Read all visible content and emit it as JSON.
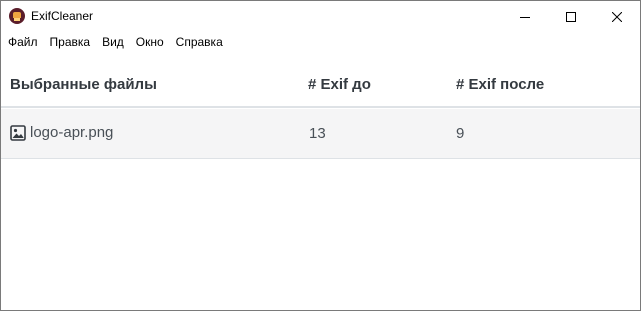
{
  "window": {
    "title": "ExifCleaner",
    "icon": "exifcleaner-logo-icon",
    "controls": [
      "minimize-icon",
      "maximize-icon",
      "close-icon"
    ]
  },
  "menu": {
    "items": [
      "Файл",
      "Правка",
      "Вид",
      "Окно",
      "Справка"
    ]
  },
  "table": {
    "headers": {
      "files": "Выбранные файлы",
      "exif_before": "# Exif до",
      "exif_after": "# Exif после"
    },
    "rows": [
      {
        "icon": "image-file-icon",
        "filename": "logo-apr.png",
        "exif_before": "13",
        "exif_after": "9"
      }
    ]
  },
  "colors": {
    "header_text": "#343a40",
    "cell_text": "#495057",
    "row_background": "#f5f5f6",
    "divider": "#dee2e6"
  }
}
